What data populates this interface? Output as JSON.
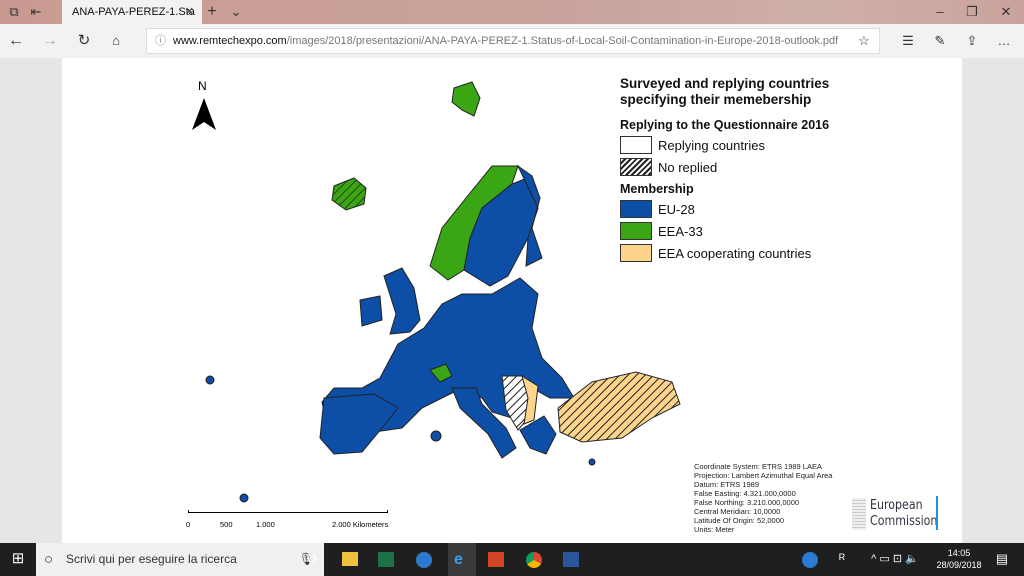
{
  "browser": {
    "tab_title": "ANA-PAYA-PEREZ-1.Sta",
    "url_domain": "www.remtechexpo.com",
    "url_path": "/images/2018/presentazioni/ANA-PAYA-PEREZ-1.Status-of-Local-Soil-Contamination-in-Europe-2018-outlook.pdf"
  },
  "legend": {
    "title": "Surveyed and replying countries specifying their memebership",
    "section1": "Replying to the Questionnaire 2016",
    "replying": "Replying countries",
    "no_replied": "No replied",
    "section2": "Membership",
    "eu28": "EU-28",
    "eea33": "EEA-33",
    "eea_coop": "EEA cooperating countries"
  },
  "colors": {
    "eu28": "#0d4ea6",
    "eea33": "#3aa614",
    "eea_coop": "#fcd48c"
  },
  "map": {
    "north": "N",
    "scale": [
      "0",
      "500",
      "1.000",
      "2.000 Kilometers"
    ]
  },
  "meta": [
    "Coordinate System: ETRS 1989 LAEA",
    "Projection: Lambert Azimuthal Equal Area",
    "Datum: ETRS 1989",
    "False Easting: 4.321.000,0000",
    "False Northing: 3.210.000,0000",
    "Central Meridian: 10,0000",
    "Latitude Of Origin: 52,0000",
    "Units: Meter"
  ],
  "logo": [
    "European",
    "Commission"
  ],
  "taskbar": {
    "search_placeholder": "Scrivi qui per eseguire la ricerca",
    "time": "14:05",
    "date": "28/09/2018"
  }
}
